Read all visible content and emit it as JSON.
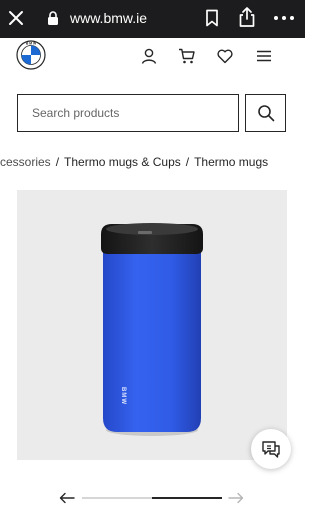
{
  "browser": {
    "url": "www.bmw.ie",
    "icons": [
      "close-icon",
      "lock-icon",
      "bookmark-icon",
      "share-icon",
      "more-icon"
    ]
  },
  "header": {
    "logo": "bmw-logo",
    "icons": [
      "user-icon",
      "cart-icon",
      "heart-icon",
      "menu-icon"
    ]
  },
  "search": {
    "placeholder": "Search products",
    "button_icon": "search-icon"
  },
  "breadcrumb": {
    "items": [
      "ccessories",
      "Thermo mugs & Cups",
      "Thermo mugs"
    ],
    "separator": "/"
  },
  "product": {
    "image": "blue-thermo-mug",
    "mug_print": "BMW",
    "chat_icon": "chat-icon"
  },
  "carousel": {
    "prev_icon": "arrow-left-icon",
    "next_icon": "arrow-right-icon",
    "progress_start": 0.5,
    "progress_end": 1.0
  },
  "colors": {
    "browser_bar": "#1c1c1e",
    "product_background": "#ebebeb",
    "mug_blue": "#2f5be6",
    "mug_lid": "#1f1f1f",
    "text": "#262626"
  }
}
